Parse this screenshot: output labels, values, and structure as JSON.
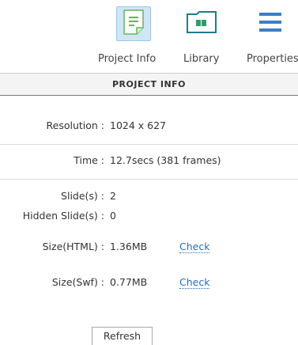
{
  "toolbar": {
    "items": [
      {
        "label": "Project Info",
        "icon": "project-info-icon",
        "selected": true
      },
      {
        "label": "Library",
        "icon": "library-icon",
        "selected": false
      },
      {
        "label": "Properties",
        "icon": "properties-icon",
        "selected": false
      }
    ]
  },
  "section": {
    "title": "PROJECT INFO"
  },
  "info": {
    "resolution": {
      "label": "Resolution :",
      "value": "1024 x 627"
    },
    "time": {
      "label": "Time :",
      "value": "12.7secs (381 frames)"
    },
    "slides": {
      "label": "Slide(s) :",
      "value": "2"
    },
    "hidden_slides": {
      "label": "Hidden Slide(s) :",
      "value": "0"
    },
    "size_html": {
      "label": "Size(HTML) :",
      "value": "1.36MB",
      "link": "Check"
    },
    "size_swf": {
      "label": "Size(Swf) :",
      "value": "0.77MB",
      "link": "Check"
    }
  },
  "actions": {
    "refresh_label": "Refresh"
  },
  "colors": {
    "selected_bg": "#cfe6f5",
    "icon_green": "#5fb85c",
    "icon_teal": "#1f7a8c",
    "icon_blue": "#3b7fc4",
    "link": "#1f6fbf"
  }
}
